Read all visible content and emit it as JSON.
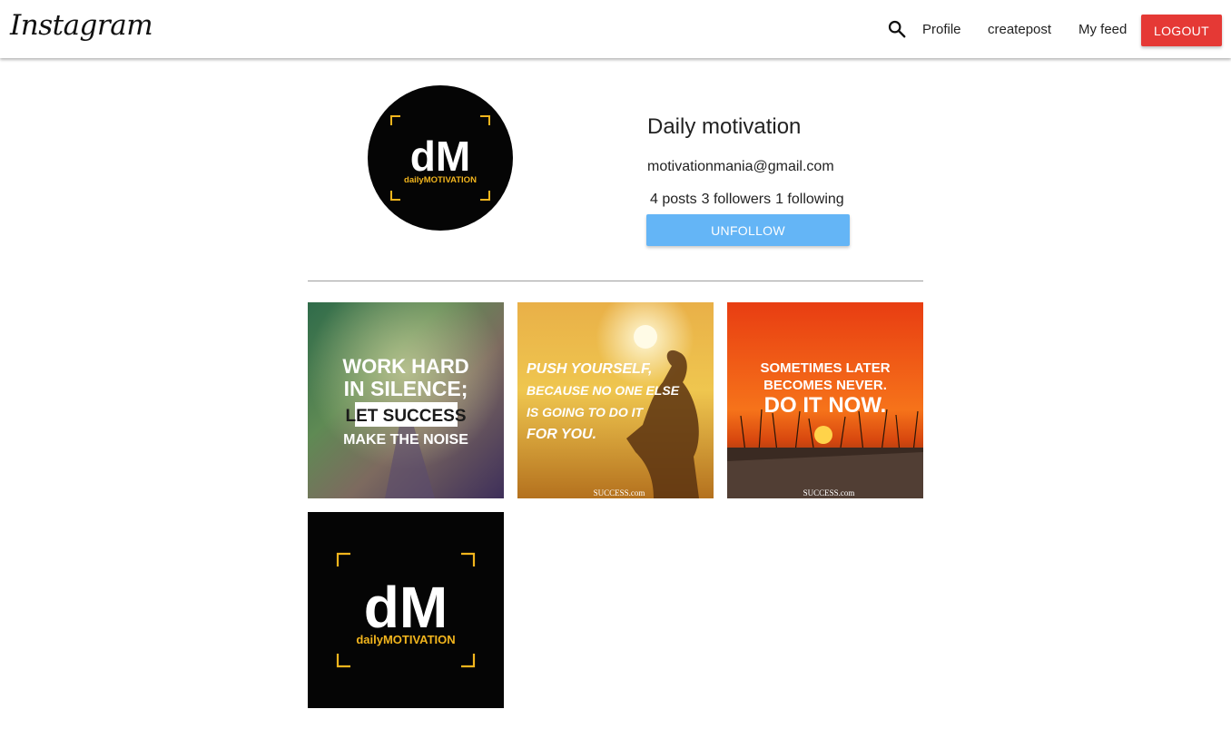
{
  "nav": {
    "brand": "Instagram",
    "links": [
      "Profile",
      "createpost",
      "My feed"
    ],
    "logout_label": "LOGOUT"
  },
  "profile": {
    "name": "Daily motivation",
    "email": "motivationmania@gmail.com",
    "stats": {
      "posts": "4 posts",
      "followers": "3 followers",
      "following": "1 following"
    },
    "unfollow_label": "UNFOLLOW",
    "avatar_logo": {
      "mark": "dM",
      "daily": "daily",
      "motivation": "MOTIVATION"
    }
  },
  "posts": [
    {
      "lines": [
        "WORK HARD",
        "IN SILENCE;",
        "LET SUCCESS",
        "MAKE THE NOISE"
      ]
    },
    {
      "lines": [
        "PUSH YOURSELF,",
        "BECAUSE NO ONE ELSE",
        "IS GOING TO DO IT",
        "FOR YOU."
      ],
      "credit": "SUCCESS.com"
    },
    {
      "lines": [
        "SOMETIMES LATER",
        "BECOMES NEVER.",
        "DO IT NOW."
      ],
      "credit": "SUCCESS.com"
    },
    {
      "logo": {
        "mark": "dM",
        "daily": "daily",
        "motivation": "MOTIVATION"
      }
    }
  ],
  "colors": {
    "logout_bg": "#e53935",
    "unfollow_bg": "#64b5f6",
    "logo_gold": "#f2b51d"
  }
}
